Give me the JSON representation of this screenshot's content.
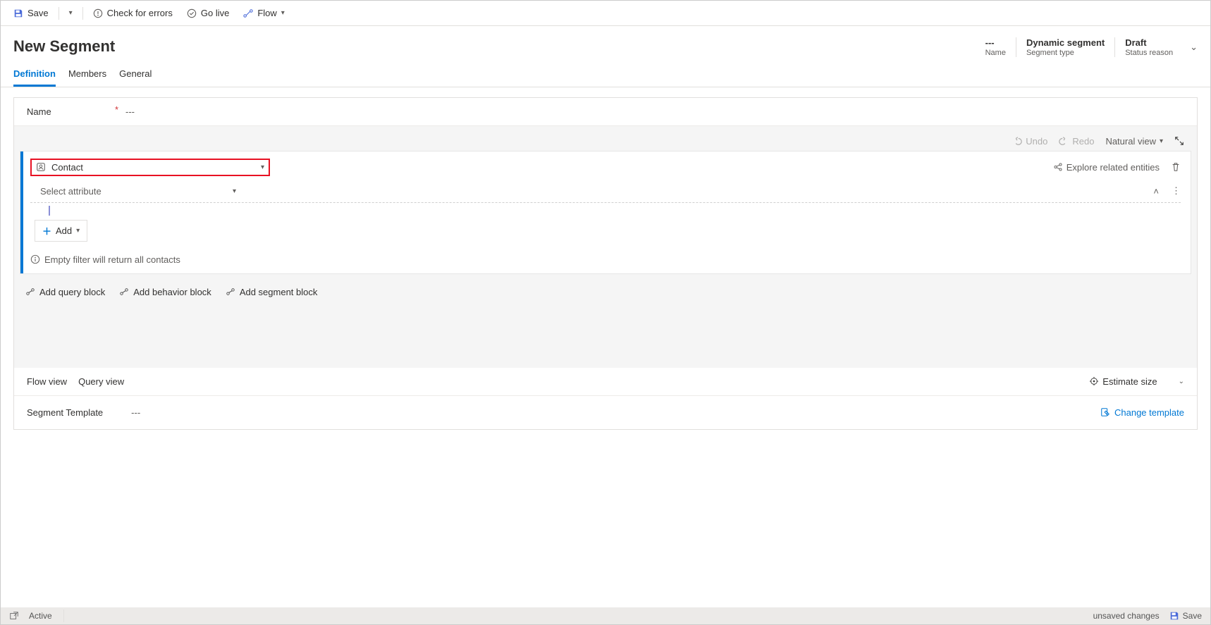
{
  "cmdbar": {
    "save": "Save",
    "check": "Check for errors",
    "golive": "Go live",
    "flow": "Flow"
  },
  "header": {
    "title": "New Segment",
    "meta": {
      "name": {
        "value": "---",
        "label": "Name"
      },
      "type": {
        "value": "Dynamic segment",
        "label": "Segment type"
      },
      "status": {
        "value": "Draft",
        "label": "Status reason"
      }
    }
  },
  "tabs": {
    "definition": "Definition",
    "members": "Members",
    "general": "General"
  },
  "form": {
    "name_label": "Name",
    "name_value": "---"
  },
  "toolbar2": {
    "undo": "Undo",
    "redo": "Redo",
    "view": "Natural view"
  },
  "block": {
    "entity": "Contact",
    "explore": "Explore related entities",
    "attr_placeholder": "Select attribute",
    "add": "Add",
    "info": "Empty filter will return all contacts"
  },
  "block_actions": {
    "query": "Add query block",
    "behavior": "Add behavior block",
    "segment": "Add segment block"
  },
  "views": {
    "flow": "Flow view",
    "query": "Query view",
    "estimate": "Estimate size"
  },
  "template": {
    "label": "Segment Template",
    "value": "---",
    "change": "Change template"
  },
  "statusbar": {
    "active": "Active",
    "unsaved": "unsaved changes",
    "save": "Save"
  }
}
